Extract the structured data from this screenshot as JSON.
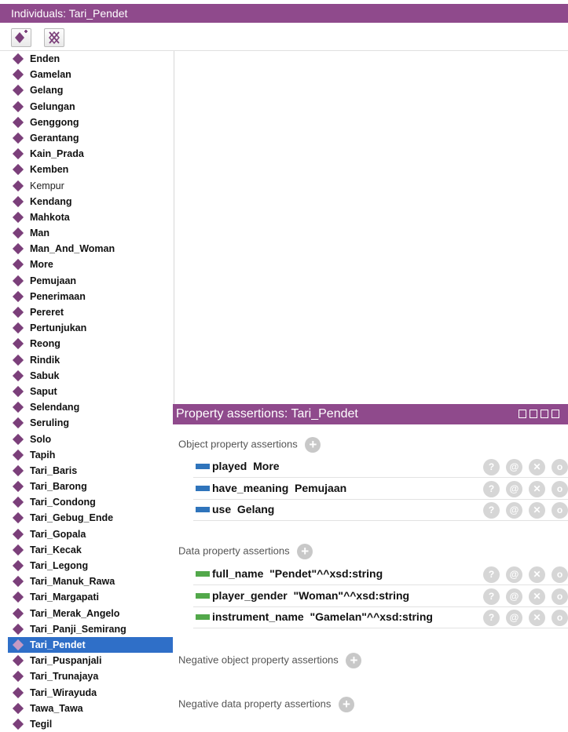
{
  "individuals_panel": {
    "title": "Individuals: Tari_Pendet",
    "toolbar": {
      "add_icon": "add-individual-icon",
      "delete_icon": "delete-individual-icon"
    },
    "items": [
      {
        "label": "Enden"
      },
      {
        "label": "Gamelan"
      },
      {
        "label": "Gelang"
      },
      {
        "label": "Gelungan"
      },
      {
        "label": "Genggong"
      },
      {
        "label": "Gerantang"
      },
      {
        "label": "Kain_Prada"
      },
      {
        "label": "Kemben"
      },
      {
        "label": "Kempur",
        "style": "normal"
      },
      {
        "label": "Kendang"
      },
      {
        "label": "Mahkota"
      },
      {
        "label": "Man"
      },
      {
        "label": "Man_And_Woman"
      },
      {
        "label": "More"
      },
      {
        "label": "Pemujaan"
      },
      {
        "label": "Penerimaan"
      },
      {
        "label": "Pereret"
      },
      {
        "label": "Pertunjukan"
      },
      {
        "label": "Reong"
      },
      {
        "label": "Rindik"
      },
      {
        "label": "Sabuk"
      },
      {
        "label": "Saput"
      },
      {
        "label": "Selendang"
      },
      {
        "label": "Seruling"
      },
      {
        "label": "Solo"
      },
      {
        "label": "Tapih"
      },
      {
        "label": "Tari_Baris"
      },
      {
        "label": "Tari_Barong"
      },
      {
        "label": "Tari_Condong"
      },
      {
        "label": "Tari_Gebug_Ende"
      },
      {
        "label": "Tari_Gopala"
      },
      {
        "label": "Tari_Kecak"
      },
      {
        "label": "Tari_Legong"
      },
      {
        "label": "Tari_Manuk_Rawa"
      },
      {
        "label": "Tari_Margapati"
      },
      {
        "label": "Tari_Merak_Angelo"
      },
      {
        "label": "Tari_Panji_Semirang"
      },
      {
        "label": "Tari_Pendet",
        "selected": true
      },
      {
        "label": "Tari_Puspanjali"
      },
      {
        "label": "Tari_Trunajaya"
      },
      {
        "label": "Tari_Wirayuda"
      },
      {
        "label": "Tawa_Tawa"
      },
      {
        "label": "Tegil"
      }
    ]
  },
  "property_panel": {
    "title": "Property assertions: Tari_Pendet",
    "sections": {
      "object": {
        "label": "Object property assertions",
        "rows": [
          {
            "property": "played",
            "value": "More"
          },
          {
            "property": "have_meaning",
            "value": "Pemujaan"
          },
          {
            "property": "use",
            "value": "Gelang"
          }
        ]
      },
      "data": {
        "label": "Data property assertions",
        "rows": [
          {
            "property": "full_name",
            "value": "\"Pendet\"^^xsd:string"
          },
          {
            "property": "player_gender",
            "value": "\"Woman\"^^xsd:string"
          },
          {
            "property": "instrument_name",
            "value": "\"Gamelan\"^^xsd:string"
          }
        ]
      },
      "neg_object": {
        "label": "Negative object property assertions"
      },
      "neg_data": {
        "label": "Negative data property assertions"
      }
    },
    "row_buttons": {
      "help": "?",
      "annotate": "@",
      "delete": "✕",
      "edit": "o"
    },
    "colors": {
      "header": "#8f4a8c",
      "object_property": "#2f74bb",
      "data_property": "#52a84a",
      "selection": "#2f6fc8"
    }
  }
}
